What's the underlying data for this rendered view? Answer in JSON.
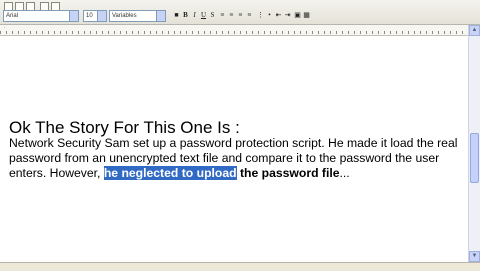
{
  "toolbar": {
    "font_name": "Arial",
    "font_size": "10",
    "style_name": "Variables"
  },
  "document": {
    "heading": "Ok The Story For This One Is :",
    "para_part1": "Network Security Sam set up a password protection script. He made it load the real password from an unencrypted text file and compare it to the password the user enters. However, ",
    "para_selected": "he neglected to upload",
    "para_space": " ",
    "para_bold": "the password file",
    "para_end": "..."
  }
}
